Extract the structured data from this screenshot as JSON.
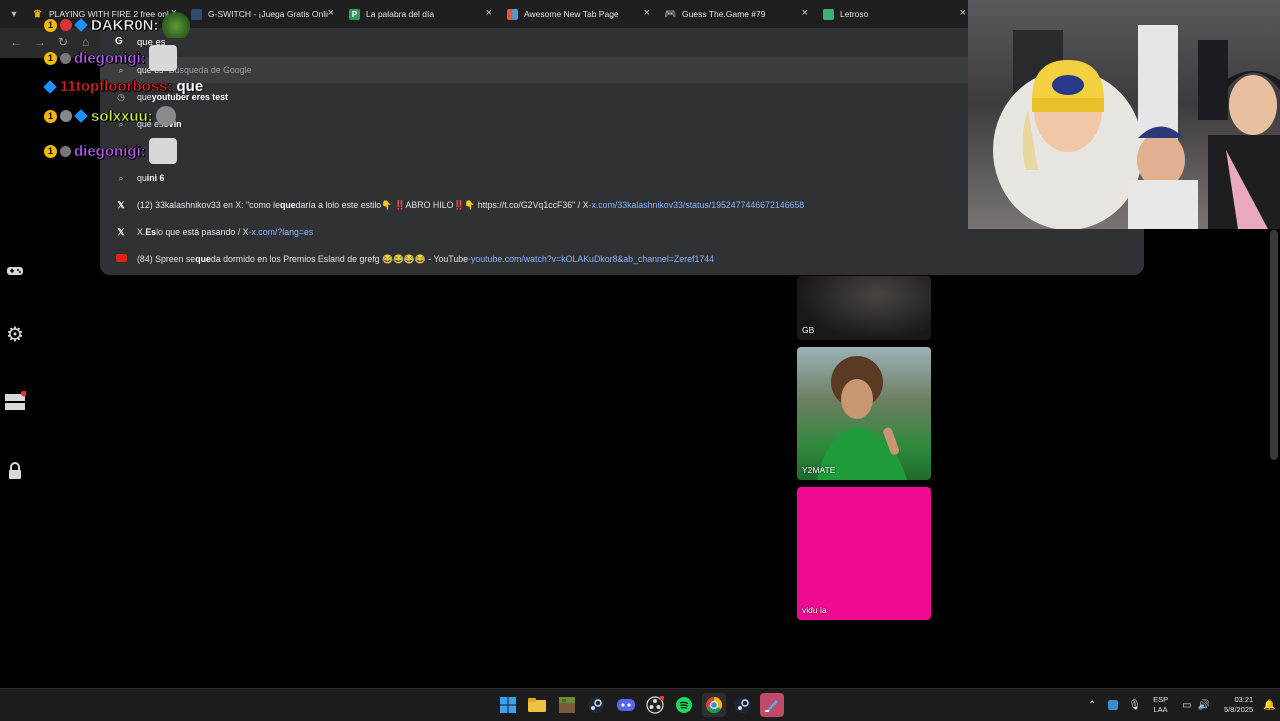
{
  "tabs": [
    {
      "title": "PLAYING WITH FIRE 2 free onli",
      "favicon": "crown-icon",
      "color": "#d9a320"
    },
    {
      "title": "G-SWITCH - ¡Juega Gratis Onlin",
      "favicon": "g-switch-icon",
      "color": "#5a9bd4"
    },
    {
      "title": "La palabra del día",
      "favicon": "p-icon",
      "color": "#2e9e5b",
      "letter": "P"
    },
    {
      "title": "Awesome New Tab Page",
      "favicon": "grid-icon",
      "color": "#e0583a"
    },
    {
      "title": "Guess The.Game #79",
      "favicon": "controller-icon",
      "color": "#7b6fd6"
    },
    {
      "title": "Letroso",
      "favicon": "letroso-icon",
      "color": "#3bb273"
    }
  ],
  "omnibox": {
    "typed": "que es",
    "suggestions": [
      {
        "icon": "search-icon",
        "pre": "que es",
        "bold": "",
        "post": "",
        "dim": " - Búsqueda de Google",
        "url": ""
      },
      {
        "icon": "history-icon",
        "pre": "que ",
        "bold": "youtuber eres test",
        "post": "",
        "dim": "",
        "url": ""
      },
      {
        "icon": "search-icon",
        "pre": "que es ",
        "bold": "ovin",
        "post": "",
        "dim": "",
        "url": ""
      },
      {
        "icon": "search-icon",
        "pre": "",
        "bold": "",
        "post": "y",
        "dim": "",
        "url": ""
      },
      {
        "icon": "search-icon",
        "pre": "qu",
        "bold": "ini 6",
        "post": "",
        "dim": "",
        "url": ""
      },
      {
        "icon": "x-icon",
        "pre": "(12) 33kalashnikov33 en X: \"como le ",
        "bold": "que",
        "post": "daría a lolo este estilo👇 ‼️ABRO HILO‼️👇 https://t.co/G2Vq1ccF36\" / X",
        "dim": " - ",
        "url": "x.com/33kalashnikov33/status/1952477446672146658"
      },
      {
        "icon": "x-icon",
        "pre": "X. ",
        "bold": "Es",
        "post": " lo que está pasando / X",
        "dim": " - ",
        "url": "x.com/?lang=es"
      },
      {
        "icon": "youtube-icon",
        "pre": "(84) Spreen se ",
        "bold": "que",
        "post": "da dormido en los Premios Esland de grefg 😂😂😂😂 - YouTube",
        "dim": " - ",
        "url": "youtube.com/watch?v=kOLAKuDkor8&ab_channel=Zeref1744"
      }
    ]
  },
  "chat": [
    {
      "name": "DAKR0N:",
      "color": "#f0f0f0",
      "msg": ""
    },
    {
      "name": "diegonigi:",
      "color": "#b45cf0",
      "msg": ""
    },
    {
      "name": "11topfloorboss:",
      "color": "#e02020",
      "msg": "que"
    },
    {
      "name": "solxxuu:",
      "color": "#c8f04a",
      "msg": ""
    },
    {
      "name": "diegonigi:",
      "color": "#b45cf0",
      "msg": ""
    }
  ],
  "tiles": [
    {
      "label": "GB",
      "color": "#2a2623"
    },
    {
      "label": "Y2MATE",
      "color": "#4a6b3a"
    },
    {
      "label": "vidu ia",
      "color": "#ef0a93"
    }
  ],
  "taskbar": {
    "apps": [
      "windows-start-icon",
      "file-explorer-icon",
      "minecraft-icon",
      "steam-icon",
      "discord-icon",
      "obs-icon",
      "spotify-icon",
      "chrome-icon",
      "steam-icon",
      "paint-icon"
    ],
    "lang_top": "ESP",
    "lang_bottom": "LAA",
    "time": "03:21",
    "date": "5/8/2025"
  }
}
